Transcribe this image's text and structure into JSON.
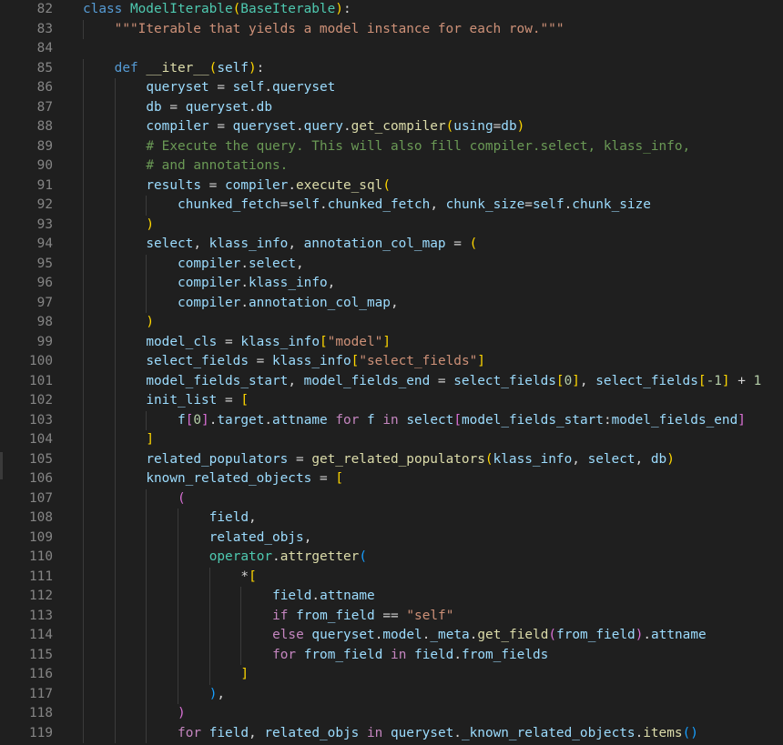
{
  "editor": {
    "lines": [
      {
        "n": "82",
        "indent": 0,
        "t": [
          [
            "class ",
            "kw"
          ],
          [
            "ModelIterable",
            "cls"
          ],
          [
            "(",
            "b1"
          ],
          [
            "BaseIterable",
            "cls"
          ],
          [
            ")",
            "b1"
          ],
          [
            ":",
            "op"
          ]
        ]
      },
      {
        "n": "83",
        "indent": 1,
        "t": [
          [
            "\"\"\"Iterable that yields a model instance for each row.\"\"\"",
            "str"
          ]
        ]
      },
      {
        "n": "84",
        "indent": 0,
        "t": []
      },
      {
        "n": "85",
        "indent": 1,
        "t": [
          [
            "def ",
            "kw"
          ],
          [
            "__iter__",
            "fn"
          ],
          [
            "(",
            "b1"
          ],
          [
            "self",
            "var"
          ],
          [
            ")",
            "b1"
          ],
          [
            ":",
            "op"
          ]
        ]
      },
      {
        "n": "86",
        "indent": 2,
        "t": [
          [
            "queryset",
            "var"
          ],
          [
            " = ",
            "op"
          ],
          [
            "self",
            "var"
          ],
          [
            ".",
            "op"
          ],
          [
            "queryset",
            "var"
          ]
        ]
      },
      {
        "n": "87",
        "indent": 2,
        "t": [
          [
            "db",
            "var"
          ],
          [
            " = ",
            "op"
          ],
          [
            "queryset",
            "var"
          ],
          [
            ".",
            "op"
          ],
          [
            "db",
            "var"
          ]
        ]
      },
      {
        "n": "88",
        "indent": 2,
        "t": [
          [
            "compiler",
            "var"
          ],
          [
            " = ",
            "op"
          ],
          [
            "queryset",
            "var"
          ],
          [
            ".",
            "op"
          ],
          [
            "query",
            "var"
          ],
          [
            ".",
            "op"
          ],
          [
            "get_compiler",
            "fn"
          ],
          [
            "(",
            "b1"
          ],
          [
            "using",
            "var"
          ],
          [
            "=",
            "op"
          ],
          [
            "db",
            "var"
          ],
          [
            ")",
            "b1"
          ]
        ]
      },
      {
        "n": "89",
        "indent": 2,
        "t": [
          [
            "# Execute the query. This will also fill compiler.select, klass_info,",
            "cmt"
          ]
        ]
      },
      {
        "n": "90",
        "indent": 2,
        "t": [
          [
            "# and annotations.",
            "cmt"
          ]
        ]
      },
      {
        "n": "91",
        "indent": 2,
        "t": [
          [
            "results",
            "var"
          ],
          [
            " = ",
            "op"
          ],
          [
            "compiler",
            "var"
          ],
          [
            ".",
            "op"
          ],
          [
            "execute_sql",
            "fn"
          ],
          [
            "(",
            "b1"
          ]
        ]
      },
      {
        "n": "92",
        "indent": 3,
        "t": [
          [
            "chunked_fetch",
            "var"
          ],
          [
            "=",
            "op"
          ],
          [
            "self",
            "var"
          ],
          [
            ".",
            "op"
          ],
          [
            "chunked_fetch",
            "var"
          ],
          [
            ", ",
            "op"
          ],
          [
            "chunk_size",
            "var"
          ],
          [
            "=",
            "op"
          ],
          [
            "self",
            "var"
          ],
          [
            ".",
            "op"
          ],
          [
            "chunk_size",
            "var"
          ]
        ]
      },
      {
        "n": "93",
        "indent": 2,
        "t": [
          [
            ")",
            "b1"
          ]
        ]
      },
      {
        "n": "94",
        "indent": 2,
        "t": [
          [
            "select",
            "var"
          ],
          [
            ", ",
            "op"
          ],
          [
            "klass_info",
            "var"
          ],
          [
            ", ",
            "op"
          ],
          [
            "annotation_col_map",
            "var"
          ],
          [
            " = ",
            "op"
          ],
          [
            "(",
            "b1"
          ]
        ]
      },
      {
        "n": "95",
        "indent": 3,
        "t": [
          [
            "compiler",
            "var"
          ],
          [
            ".",
            "op"
          ],
          [
            "select",
            "var"
          ],
          [
            ",",
            "op"
          ]
        ]
      },
      {
        "n": "96",
        "indent": 3,
        "t": [
          [
            "compiler",
            "var"
          ],
          [
            ".",
            "op"
          ],
          [
            "klass_info",
            "var"
          ],
          [
            ",",
            "op"
          ]
        ]
      },
      {
        "n": "97",
        "indent": 3,
        "t": [
          [
            "compiler",
            "var"
          ],
          [
            ".",
            "op"
          ],
          [
            "annotation_col_map",
            "var"
          ],
          [
            ",",
            "op"
          ]
        ]
      },
      {
        "n": "98",
        "indent": 2,
        "t": [
          [
            ")",
            "b1"
          ]
        ]
      },
      {
        "n": "99",
        "indent": 2,
        "t": [
          [
            "model_cls",
            "var"
          ],
          [
            " = ",
            "op"
          ],
          [
            "klass_info",
            "var"
          ],
          [
            "[",
            "b1"
          ],
          [
            "\"model\"",
            "str"
          ],
          [
            "]",
            "b1"
          ]
        ]
      },
      {
        "n": "100",
        "indent": 2,
        "t": [
          [
            "select_fields",
            "var"
          ],
          [
            " = ",
            "op"
          ],
          [
            "klass_info",
            "var"
          ],
          [
            "[",
            "b1"
          ],
          [
            "\"select_fields\"",
            "str"
          ],
          [
            "]",
            "b1"
          ]
        ]
      },
      {
        "n": "101",
        "indent": 2,
        "t": [
          [
            "model_fields_start",
            "var"
          ],
          [
            ", ",
            "op"
          ],
          [
            "model_fields_end",
            "var"
          ],
          [
            " = ",
            "op"
          ],
          [
            "select_fields",
            "var"
          ],
          [
            "[",
            "b1"
          ],
          [
            "0",
            "num"
          ],
          [
            "]",
            "b1"
          ],
          [
            ", ",
            "op"
          ],
          [
            "select_fields",
            "var"
          ],
          [
            "[",
            "b1"
          ],
          [
            "-1",
            "num"
          ],
          [
            "]",
            "b1"
          ],
          [
            " + ",
            "op"
          ],
          [
            "1",
            "num"
          ]
        ]
      },
      {
        "n": "102",
        "indent": 2,
        "t": [
          [
            "init_list",
            "var"
          ],
          [
            " = ",
            "op"
          ],
          [
            "[",
            "b1"
          ]
        ]
      },
      {
        "n": "103",
        "indent": 3,
        "t": [
          [
            "f",
            "var"
          ],
          [
            "[",
            "b2"
          ],
          [
            "0",
            "num"
          ],
          [
            "]",
            "b2"
          ],
          [
            ".",
            "op"
          ],
          [
            "target",
            "var"
          ],
          [
            ".",
            "op"
          ],
          [
            "attname",
            "var"
          ],
          [
            " for ",
            "ctl"
          ],
          [
            "f",
            "var"
          ],
          [
            " in ",
            "ctl"
          ],
          [
            "select",
            "var"
          ],
          [
            "[",
            "b2"
          ],
          [
            "model_fields_start",
            "var"
          ],
          [
            ":",
            "op"
          ],
          [
            "model_fields_end",
            "var"
          ],
          [
            "]",
            "b2"
          ]
        ]
      },
      {
        "n": "104",
        "indent": 2,
        "t": [
          [
            "]",
            "b1"
          ]
        ]
      },
      {
        "n": "105",
        "indent": 2,
        "t": [
          [
            "related_populators",
            "var"
          ],
          [
            " = ",
            "op"
          ],
          [
            "get_related_populators",
            "fn"
          ],
          [
            "(",
            "b1"
          ],
          [
            "klass_info",
            "var"
          ],
          [
            ", ",
            "op"
          ],
          [
            "select",
            "var"
          ],
          [
            ", ",
            "op"
          ],
          [
            "db",
            "var"
          ],
          [
            ")",
            "b1"
          ]
        ]
      },
      {
        "n": "106",
        "indent": 2,
        "t": [
          [
            "known_related_objects",
            "var"
          ],
          [
            " = ",
            "op"
          ],
          [
            "[",
            "b1"
          ]
        ]
      },
      {
        "n": "107",
        "indent": 3,
        "t": [
          [
            "(",
            "b2"
          ]
        ]
      },
      {
        "n": "108",
        "indent": 4,
        "t": [
          [
            "field",
            "var"
          ],
          [
            ",",
            "op"
          ]
        ]
      },
      {
        "n": "109",
        "indent": 4,
        "t": [
          [
            "related_objs",
            "var"
          ],
          [
            ",",
            "op"
          ]
        ]
      },
      {
        "n": "110",
        "indent": 4,
        "t": [
          [
            "operator",
            "cls"
          ],
          [
            ".",
            "op"
          ],
          [
            "attrgetter",
            "fn"
          ],
          [
            "(",
            "b3"
          ]
        ]
      },
      {
        "n": "111",
        "indent": 5,
        "t": [
          [
            "*",
            "op"
          ],
          [
            "[",
            "b1"
          ]
        ]
      },
      {
        "n": "112",
        "indent": 6,
        "t": [
          [
            "field",
            "var"
          ],
          [
            ".",
            "op"
          ],
          [
            "attname",
            "var"
          ]
        ]
      },
      {
        "n": "113",
        "indent": 6,
        "t": [
          [
            "if ",
            "ctl"
          ],
          [
            "from_field",
            "var"
          ],
          [
            " == ",
            "op"
          ],
          [
            "\"self\"",
            "str"
          ]
        ]
      },
      {
        "n": "114",
        "indent": 6,
        "t": [
          [
            "else ",
            "ctl"
          ],
          [
            "queryset",
            "var"
          ],
          [
            ".",
            "op"
          ],
          [
            "model",
            "var"
          ],
          [
            ".",
            "op"
          ],
          [
            "_meta",
            "var"
          ],
          [
            ".",
            "op"
          ],
          [
            "get_field",
            "fn"
          ],
          [
            "(",
            "b2"
          ],
          [
            "from_field",
            "var"
          ],
          [
            ")",
            "b2"
          ],
          [
            ".",
            "op"
          ],
          [
            "attname",
            "var"
          ]
        ]
      },
      {
        "n": "115",
        "indent": 6,
        "t": [
          [
            "for ",
            "ctl"
          ],
          [
            "from_field",
            "var"
          ],
          [
            " in ",
            "ctl"
          ],
          [
            "field",
            "var"
          ],
          [
            ".",
            "op"
          ],
          [
            "from_fields",
            "var"
          ]
        ]
      },
      {
        "n": "116",
        "indent": 5,
        "t": [
          [
            "]",
            "b1"
          ]
        ]
      },
      {
        "n": "117",
        "indent": 4,
        "t": [
          [
            ")",
            "b3"
          ],
          [
            ",",
            "op"
          ]
        ]
      },
      {
        "n": "118",
        "indent": 3,
        "t": [
          [
            ")",
            "b2"
          ]
        ]
      },
      {
        "n": "119",
        "indent": 3,
        "t": [
          [
            "for ",
            "ctl"
          ],
          [
            "field",
            "var"
          ],
          [
            ", ",
            "op"
          ],
          [
            "related_objs",
            "var"
          ],
          [
            " in ",
            "ctl"
          ],
          [
            "queryset",
            "var"
          ],
          [
            ".",
            "op"
          ],
          [
            "_known_related_objects",
            "var"
          ],
          [
            ".",
            "op"
          ],
          [
            "items",
            "fn"
          ],
          [
            "(",
            "b3"
          ],
          [
            ")",
            "b3"
          ]
        ]
      }
    ]
  }
}
